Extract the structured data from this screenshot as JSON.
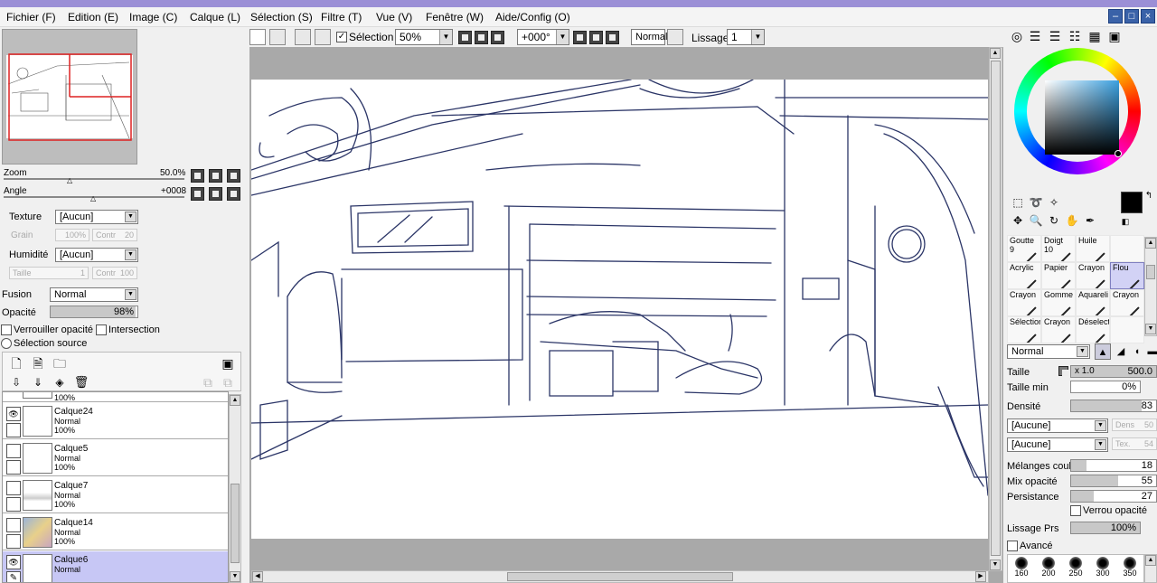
{
  "menu": [
    "Fichier (F)",
    "Edition (E)",
    "Image (C)",
    "Calque (L)",
    "Sélection (S)",
    "Filtre (T)",
    "Vue (V)",
    "Fenêtre (W)",
    "Aide/Config (O)"
  ],
  "toolbar": {
    "selection_label": "Sélection",
    "zoom": "50%",
    "rotation": "+000°",
    "mode": "Normal",
    "lissage_label": "Lissage",
    "lissage_value": "1"
  },
  "navigator": {
    "zoom_label": "Zoom",
    "zoom_value": "50.0%",
    "angle_label": "Angle",
    "angle_value": "+0008"
  },
  "texture": {
    "texture_label": "Texture",
    "texture_value": "[Aucun]",
    "grain_label": "Grain",
    "grain_value": "100%",
    "contr_label": "Contr",
    "contr_value": "20",
    "humidite_label": "Humidité",
    "humidite_value": "[Aucun]",
    "taille_label": "Taille",
    "taille_value": "1",
    "contr2_value": "100"
  },
  "layer_props": {
    "fusion_label": "Fusion",
    "fusion_value": "Normal",
    "opacite_label": "Opacité",
    "opacite_value": "98%",
    "opacite_fraction": 0.98,
    "verrou_label": "Verrouiller opacité",
    "intersection_label": "Intersection",
    "source_label": "Sélection source"
  },
  "layers": [
    {
      "name": "",
      "mode": "",
      "opacity": "100%",
      "selected": false,
      "visible": false
    },
    {
      "name": "Calque24",
      "mode": "Normal",
      "opacity": "100%",
      "selected": false,
      "visible": true
    },
    {
      "name": "Calque5",
      "mode": "Normal",
      "opacity": "100%",
      "selected": false,
      "visible": false
    },
    {
      "name": "Calque7",
      "mode": "Normal",
      "opacity": "100%",
      "selected": false,
      "visible": false
    },
    {
      "name": "Calque14",
      "mode": "Normal",
      "opacity": "100%",
      "selected": false,
      "visible": false
    },
    {
      "name": "Calque6",
      "mode": "Normal",
      "opacity": "",
      "selected": true,
      "visible": true
    }
  ],
  "brushes": [
    {
      "label": "Goutte",
      "sub": "9"
    },
    {
      "label": "Doigt",
      "sub": "10"
    },
    {
      "label": "Huile",
      "sub": ""
    },
    {
      "label": "",
      "sub": ""
    },
    {
      "label": "Acrylic",
      "sub": ""
    },
    {
      "label": "Papier",
      "sub": ""
    },
    {
      "label": "Crayon",
      "sub": ""
    },
    {
      "label": "Flou",
      "sub": ""
    },
    {
      "label": "Crayon",
      "sub": ""
    },
    {
      "label": "Gomme",
      "sub": ""
    },
    {
      "label": "Aquareli",
      "sub": ""
    },
    {
      "label": "Crayon",
      "sub": ""
    },
    {
      "label": "Sélection",
      "sub": ""
    },
    {
      "label": "Crayon",
      "sub": ""
    },
    {
      "label": "Déselect",
      "sub": ""
    },
    {
      "label": "",
      "sub": ""
    }
  ],
  "brush_props": {
    "mode": "Normal",
    "taille_label": "Taille",
    "taille_mult": "x 1.0",
    "taille_value": "500.0",
    "taille_min_label": "Taille min",
    "taille_min_value": "0%",
    "densite_label": "Densité",
    "densite_value": "83",
    "densite_fraction": 0.83,
    "shape1": "[Aucune]",
    "shape1_label": "Dens",
    "shape1_value": "50",
    "shape2": "[Aucune]",
    "shape2_label": "Tex.",
    "shape2_value": "54",
    "melanges_label": "Mélanges coul",
    "melanges_value": "18",
    "melanges_fraction": 0.18,
    "mix_label": "Mix opacité",
    "mix_value": "55",
    "mix_fraction": 0.55,
    "persistance_label": "Persistance",
    "persistance_value": "27",
    "persistance_fraction": 0.27,
    "verrou_label": "Verrou opacité",
    "lissage_label": "Lissage Prs",
    "lissage_value": "100%",
    "lissage_fraction": 1.0,
    "avance_label": "Avancé"
  },
  "brush_sizes": [
    "160",
    "200",
    "250",
    "300",
    "350"
  ],
  "colors": {
    "accent_selection": "#c7c7f5",
    "current_color": "#000000",
    "title_bar": "#9b8fd6"
  }
}
